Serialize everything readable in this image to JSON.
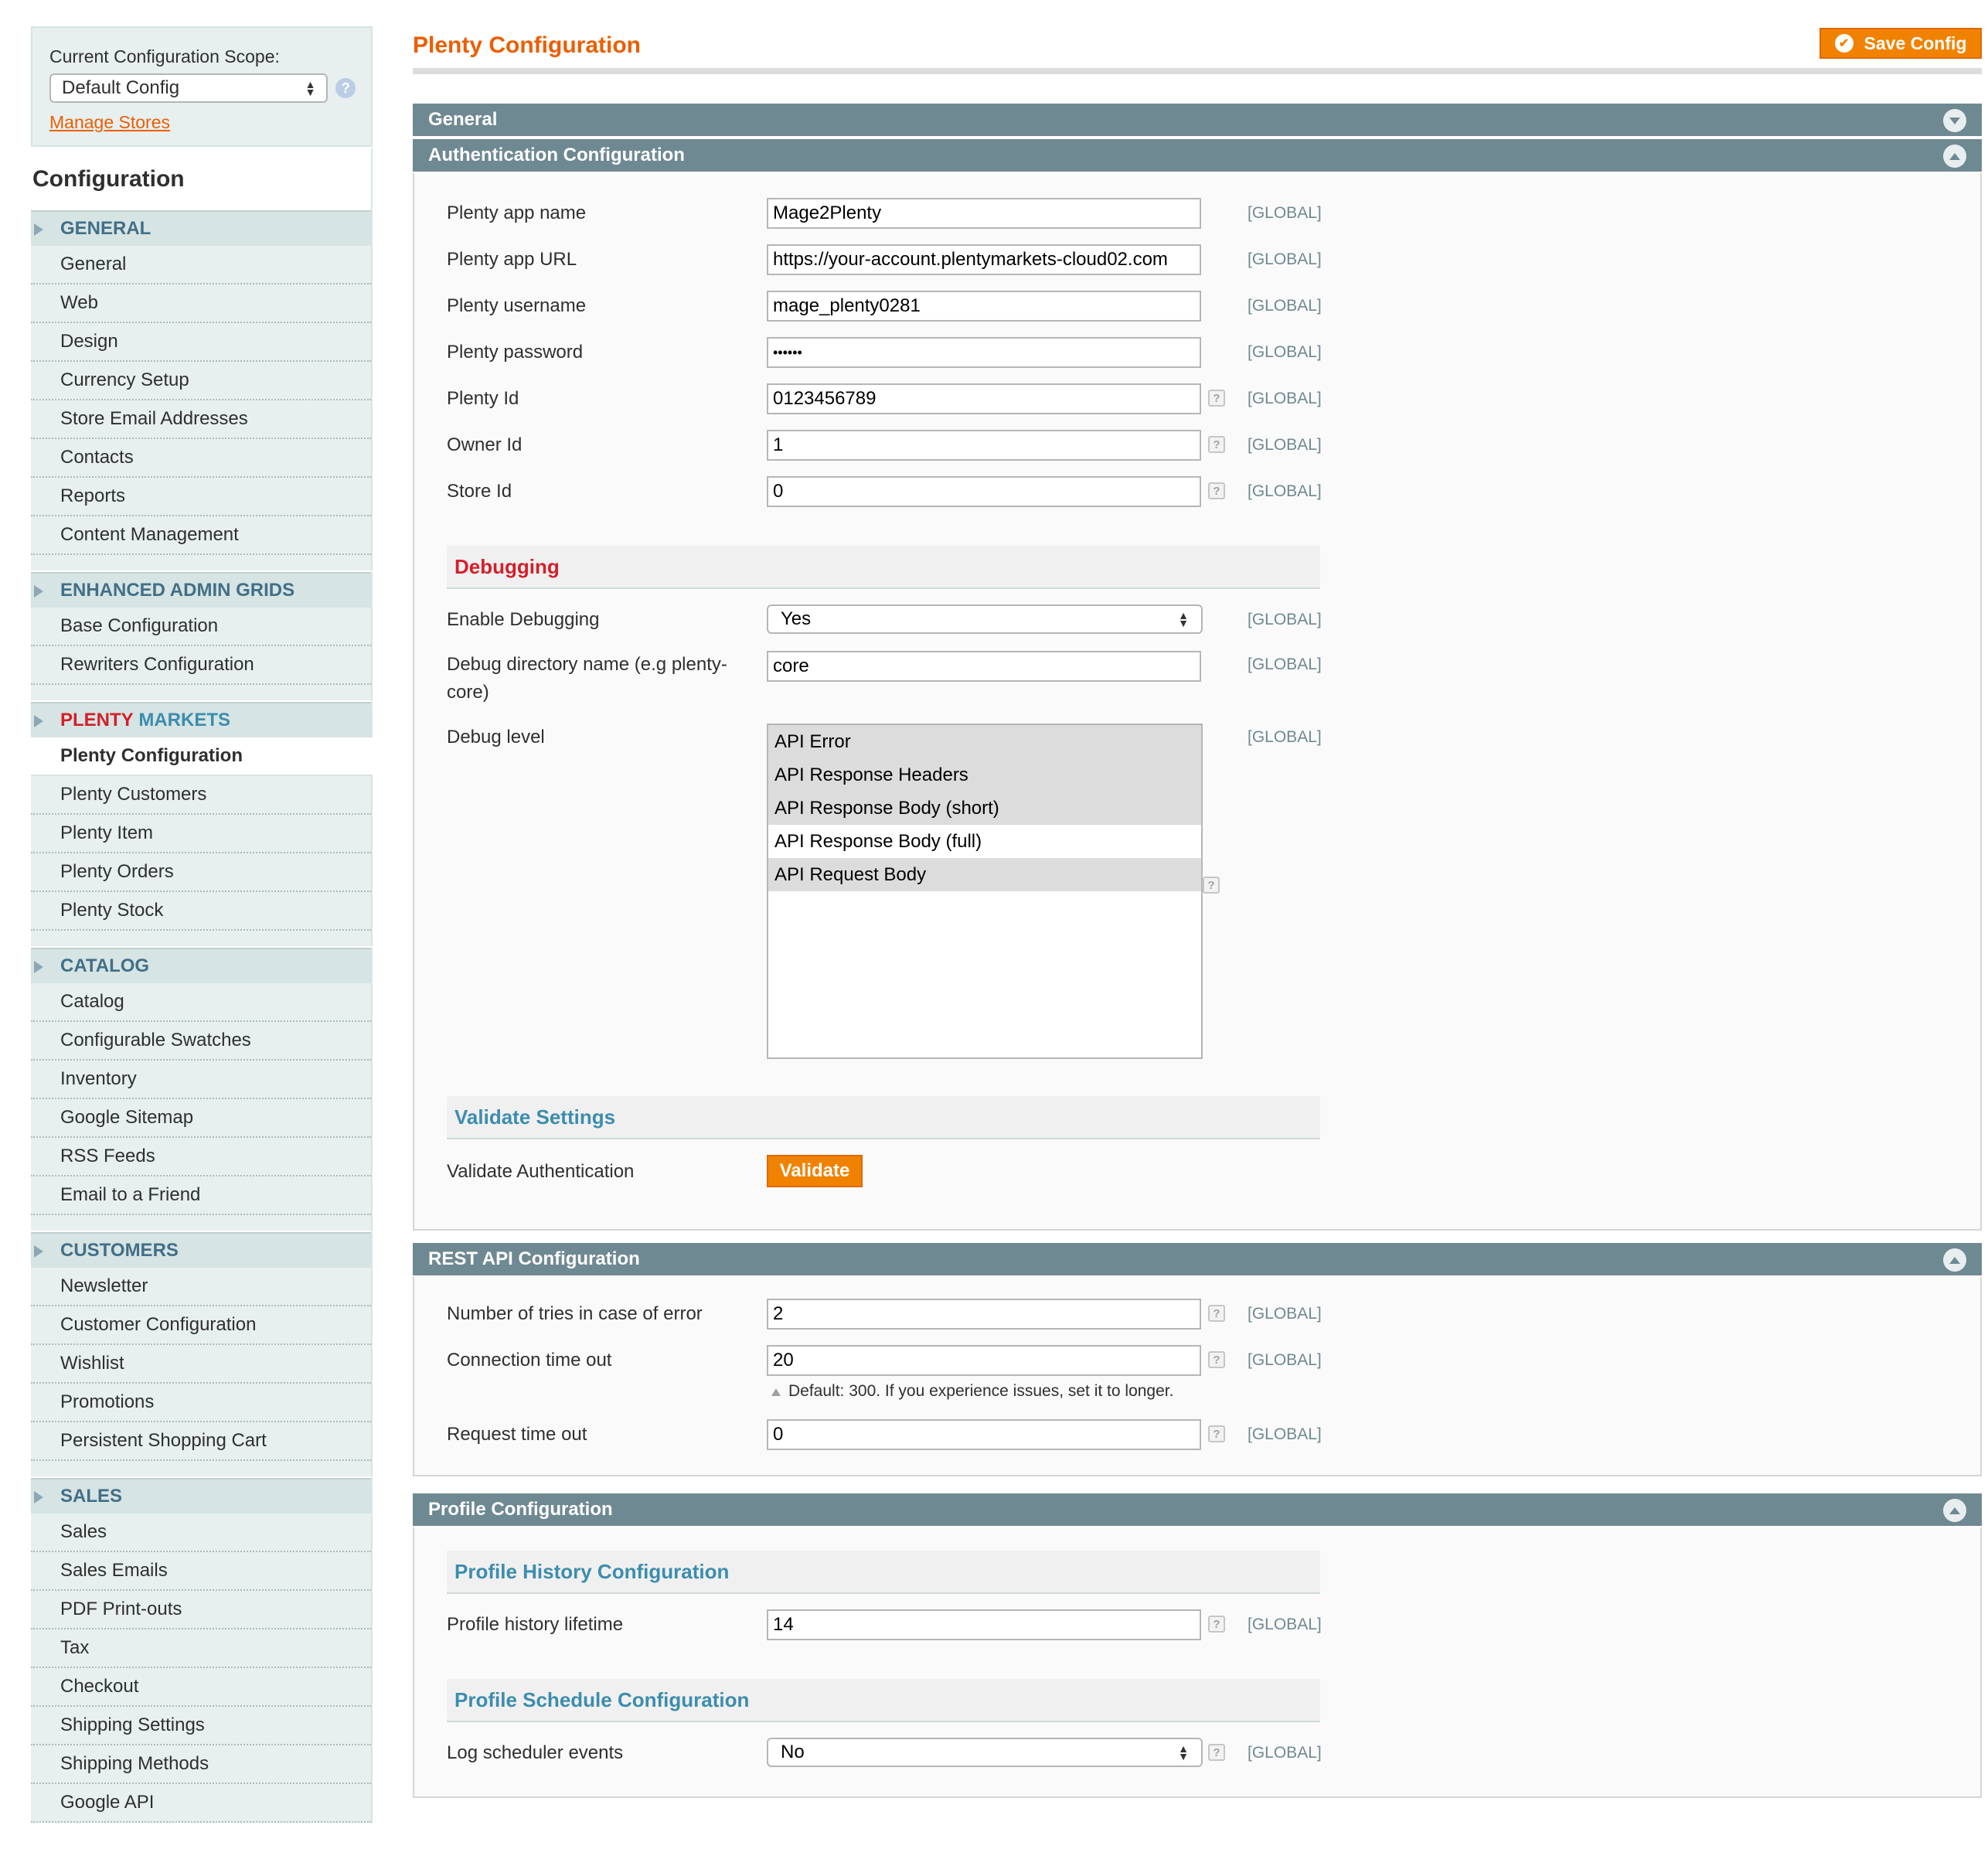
{
  "sidebar": {
    "scope_label": "Current Configuration Scope:",
    "scope_value": "Default Config",
    "manage_stores": "Manage Stores",
    "config_title": "Configuration",
    "groups": [
      {
        "title": "GENERAL",
        "items": [
          "General",
          "Web",
          "Design",
          "Currency Setup",
          "Store Email Addresses",
          "Contacts",
          "Reports",
          "Content Management"
        ]
      },
      {
        "title": "ENHANCED ADMIN GRIDS",
        "items": [
          "Base Configuration",
          "Rewriters Configuration"
        ]
      },
      {
        "title_part1": "PLENTY",
        "title_part2": "MARKETS",
        "active_item": "Plenty Configuration",
        "items": [
          "Plenty Customers",
          "Plenty Item",
          "Plenty Orders",
          "Plenty Stock"
        ]
      },
      {
        "title": "CATALOG",
        "items": [
          "Catalog",
          "Configurable Swatches",
          "Inventory",
          "Google Sitemap",
          "RSS Feeds",
          "Email to a Friend"
        ]
      },
      {
        "title": "CUSTOMERS",
        "items": [
          "Newsletter",
          "Customer Configuration",
          "Wishlist",
          "Promotions",
          "Persistent Shopping Cart"
        ]
      },
      {
        "title": "SALES",
        "items": [
          "Sales",
          "Sales Emails",
          "PDF Print-outs",
          "Tax",
          "Checkout",
          "Shipping Settings",
          "Shipping Methods",
          "Google API"
        ]
      }
    ]
  },
  "main": {
    "title": "Plenty Configuration",
    "save_button": "Save Config",
    "sections": {
      "general": "General",
      "auth": "Authentication Configuration",
      "rest": "REST API Configuration",
      "profile": "Profile Configuration"
    },
    "scope_tag": "[GLOBAL]",
    "auth": {
      "app_name": {
        "label": "Plenty app name",
        "value": "Mage2Plenty"
      },
      "app_url": {
        "label": "Plenty app URL",
        "value": "https://your-account.plentymarkets-cloud02.com"
      },
      "username": {
        "label": "Plenty username",
        "value": "mage_plenty0281"
      },
      "password": {
        "label": "Plenty password",
        "value": "••••••"
      },
      "plenty_id": {
        "label": "Plenty Id",
        "value": "0123456789"
      },
      "owner_id": {
        "label": "Owner Id",
        "value": "1"
      },
      "store_id": {
        "label": "Store Id",
        "value": "0"
      }
    },
    "debugging": {
      "heading": "Debugging",
      "enable": {
        "label": "Enable Debugging",
        "value": "Yes"
      },
      "directory_label_1": "Debug directory name (e.g plenty-",
      "directory_label_2": "core)",
      "directory_value": "core",
      "level_label": "Debug level",
      "level_options": [
        {
          "label": "API Error",
          "selected": true
        },
        {
          "label": "API Response Headers",
          "selected": true
        },
        {
          "label": "API Response Body (short)",
          "selected": true
        },
        {
          "label": "API Response Body (full)",
          "selected": false
        },
        {
          "label": "API Request Body",
          "selected": true
        }
      ]
    },
    "validate": {
      "heading": "Validate Settings",
      "label": "Validate Authentication",
      "button": "Validate"
    },
    "rest": {
      "tries": {
        "label": "Number of tries in case of error",
        "value": "2"
      },
      "conn_timeout": {
        "label": "Connection time out",
        "value": "20",
        "note": "Default: 300. If you experience issues, set it to longer."
      },
      "req_timeout": {
        "label": "Request time out",
        "value": "0"
      }
    },
    "profile": {
      "history_heading": "Profile History Configuration",
      "history_label": "Profile history lifetime",
      "history_value": "14",
      "schedule_heading": "Profile Schedule Configuration",
      "log_label": "Log scheduler events",
      "log_value": "No"
    }
  }
}
